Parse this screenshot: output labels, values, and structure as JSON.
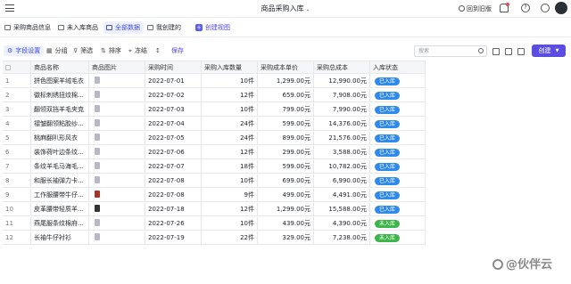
{
  "header": {
    "title": "商品采购入库",
    "back_to_old": "回到旧版"
  },
  "tabs": [
    {
      "label": "采购商品信息",
      "active": false
    },
    {
      "label": "未入库商品",
      "active": false
    },
    {
      "label": "全部数据",
      "active": true
    },
    {
      "label": "我创建的",
      "active": false
    },
    {
      "label": "创建视图",
      "active": false
    }
  ],
  "toolbar": {
    "field_settings": "字段设置",
    "group": "分组",
    "filter": "筛选",
    "sort": "排序",
    "freeze": "冻结",
    "save": "保存",
    "search_placeholder": "搜索",
    "create": "创建"
  },
  "table": {
    "columns": [
      "商品名称",
      "商品图片",
      "采购时间",
      "采购入库数量",
      "采购成本单价",
      "采购总成本",
      "入库状态"
    ],
    "rows": [
      {
        "no": "1",
        "name": "拼色图案羊绒毛衣",
        "thumb": "light",
        "date": "2022-07-01",
        "qty": "10件",
        "price": "1,299.00元",
        "total": "12,990.00元",
        "status": "已入库"
      },
      {
        "no": "2",
        "name": "徽标刺绣扭纹棉...",
        "thumb": "light",
        "date": "2022-07-02",
        "qty": "12件",
        "price": "659.00元",
        "total": "7,908.00元",
        "status": "已入库"
      },
      {
        "no": "3",
        "name": "翻领双挡羊毛夹克",
        "thumb": "light",
        "date": "2022-07-03",
        "qty": "10件",
        "price": "799.00元",
        "total": "7,990.00元",
        "status": "已入库"
      },
      {
        "no": "4",
        "name": "褶皱翻领粘胶纱...",
        "thumb": "light",
        "date": "2022-07-04",
        "qty": "24件",
        "price": "599.00元",
        "total": "14,376.00元",
        "status": "已入库"
      },
      {
        "no": "5",
        "name": "桃麻翻叭形风衣",
        "thumb": "light",
        "date": "2022-07-05",
        "qty": "24件",
        "price": "899.00元",
        "total": "21,576.00元",
        "status": "已入库"
      },
      {
        "no": "6",
        "name": "装饰荷叶边条纹...",
        "thumb": "light",
        "date": "2022-07-06",
        "qty": "12件",
        "price": "299.00元",
        "total": "3,588.00元",
        "status": "已入库"
      },
      {
        "no": "7",
        "name": "条纹羊毛马海毛...",
        "thumb": "light",
        "date": "2022-07-07",
        "qty": "18件",
        "price": "599.00元",
        "total": "10,782.00元",
        "status": "已入库"
      },
      {
        "no": "8",
        "name": "和服长袖弹力卡...",
        "thumb": "light",
        "date": "2022-07-08",
        "qty": "10件",
        "price": "699.00元",
        "total": "6,990.00元",
        "status": "已入库"
      },
      {
        "no": "9",
        "name": "工作服腰带牛仔...",
        "thumb": "red",
        "date": "2022-07-08",
        "qty": "9件",
        "price": "499.00元",
        "total": "4,491.00元",
        "status": "已入库"
      },
      {
        "no": "10",
        "name": "皮革腰带轻质羊...",
        "thumb": "dark",
        "date": "2022-07-18",
        "qty": "12件",
        "price": "1,299.00元",
        "total": "15,588.00元",
        "status": "已入库"
      },
      {
        "no": "11",
        "name": "燕尾服条纹棉府...",
        "thumb": "light",
        "date": "2022-07-26",
        "qty": "10件",
        "price": "439.00元",
        "total": "4,390.00元",
        "status": "未入库"
      },
      {
        "no": "12",
        "name": "长袖牛仔衬衫",
        "thumb": "light",
        "date": "2022-07-19",
        "qty": "22件",
        "price": "329.00元",
        "total": "7,238.00元",
        "status": "未入库"
      }
    ]
  },
  "watermark": "@伙伴云"
}
